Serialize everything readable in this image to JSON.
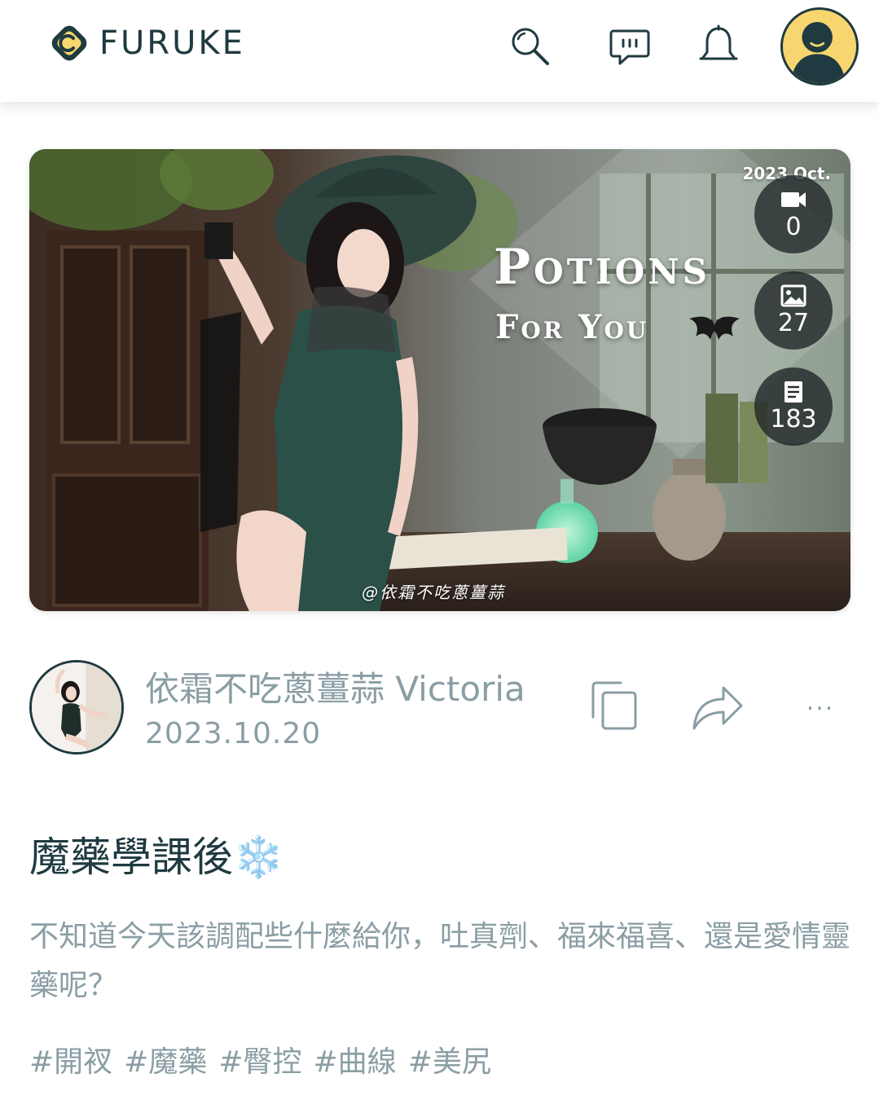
{
  "header": {
    "brand": "FURUKE",
    "icons": {
      "search": "search-icon",
      "messages": "chat-bubble-icon",
      "notifications": "bell-icon",
      "profile": "user-avatar-icon"
    },
    "colors": {
      "brand_dark": "#1f3a40",
      "brand_yellow": "#f7d670"
    }
  },
  "hero": {
    "date_label": "2023 Oct.",
    "title": "Potions",
    "subtitle": "For You",
    "watermark": "@依霜不吃蔥薑蒜",
    "stats": [
      {
        "icon": "video-camera-icon",
        "value": "0"
      },
      {
        "icon": "image-icon",
        "value": "27"
      },
      {
        "icon": "document-icon",
        "value": "183"
      }
    ]
  },
  "author": {
    "name": "依霜不吃蔥薑蒜 Victoria",
    "date": "2023.10.20"
  },
  "actions": {
    "copy": "copy-icon",
    "share": "share-icon",
    "more": "..."
  },
  "post": {
    "title": "魔藥學課後",
    "title_emoji": "❄️",
    "body": "不知道今天該調配些什麼給你，吐真劑、福來福喜、還是愛情靈藥呢？",
    "tags": [
      "#開衩",
      "#魔藥",
      "#臀控",
      "#曲線",
      "#美尻"
    ]
  }
}
